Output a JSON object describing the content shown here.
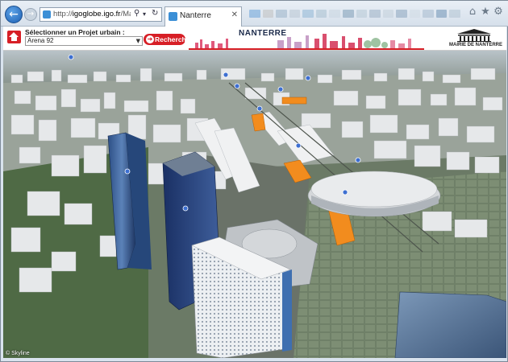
{
  "browser": {
    "url_prefix": "http://",
    "url_domain": "igoglobe.igo.fr",
    "url_path": "/Maquette/Nar",
    "tab_title": "Nanterre",
    "icons": [
      "back-icon",
      "forward-icon",
      "search-icon",
      "dropdown-icon",
      "refresh-icon",
      "close-icon",
      "home-icon",
      "star-icon",
      "gear-icon"
    ],
    "extension_colors": [
      "#6aa3d8",
      "#c0c0c0",
      "#9ab3c9",
      "#b9c7d3",
      "#8fb7d6",
      "#a8bfcf",
      "#c9d6e0",
      "#7e9cb7",
      "#b7c8d6",
      "#9db1c4",
      "#c2cfda",
      "#8aa4bd",
      "#d0dbe4",
      "#a6bacd",
      "#6d91b5",
      "#b1c2d2"
    ]
  },
  "header": {
    "select_label": "Sélectionner un Projet urbain :",
    "selected_project": "Arena 92",
    "search_button": "Rechercher",
    "banner_title": "NANTERRE",
    "logo_text": "MAIRIE DE NANTERRE",
    "accent_color": "#d71f26"
  },
  "map": {
    "credit": "© Skyline"
  }
}
